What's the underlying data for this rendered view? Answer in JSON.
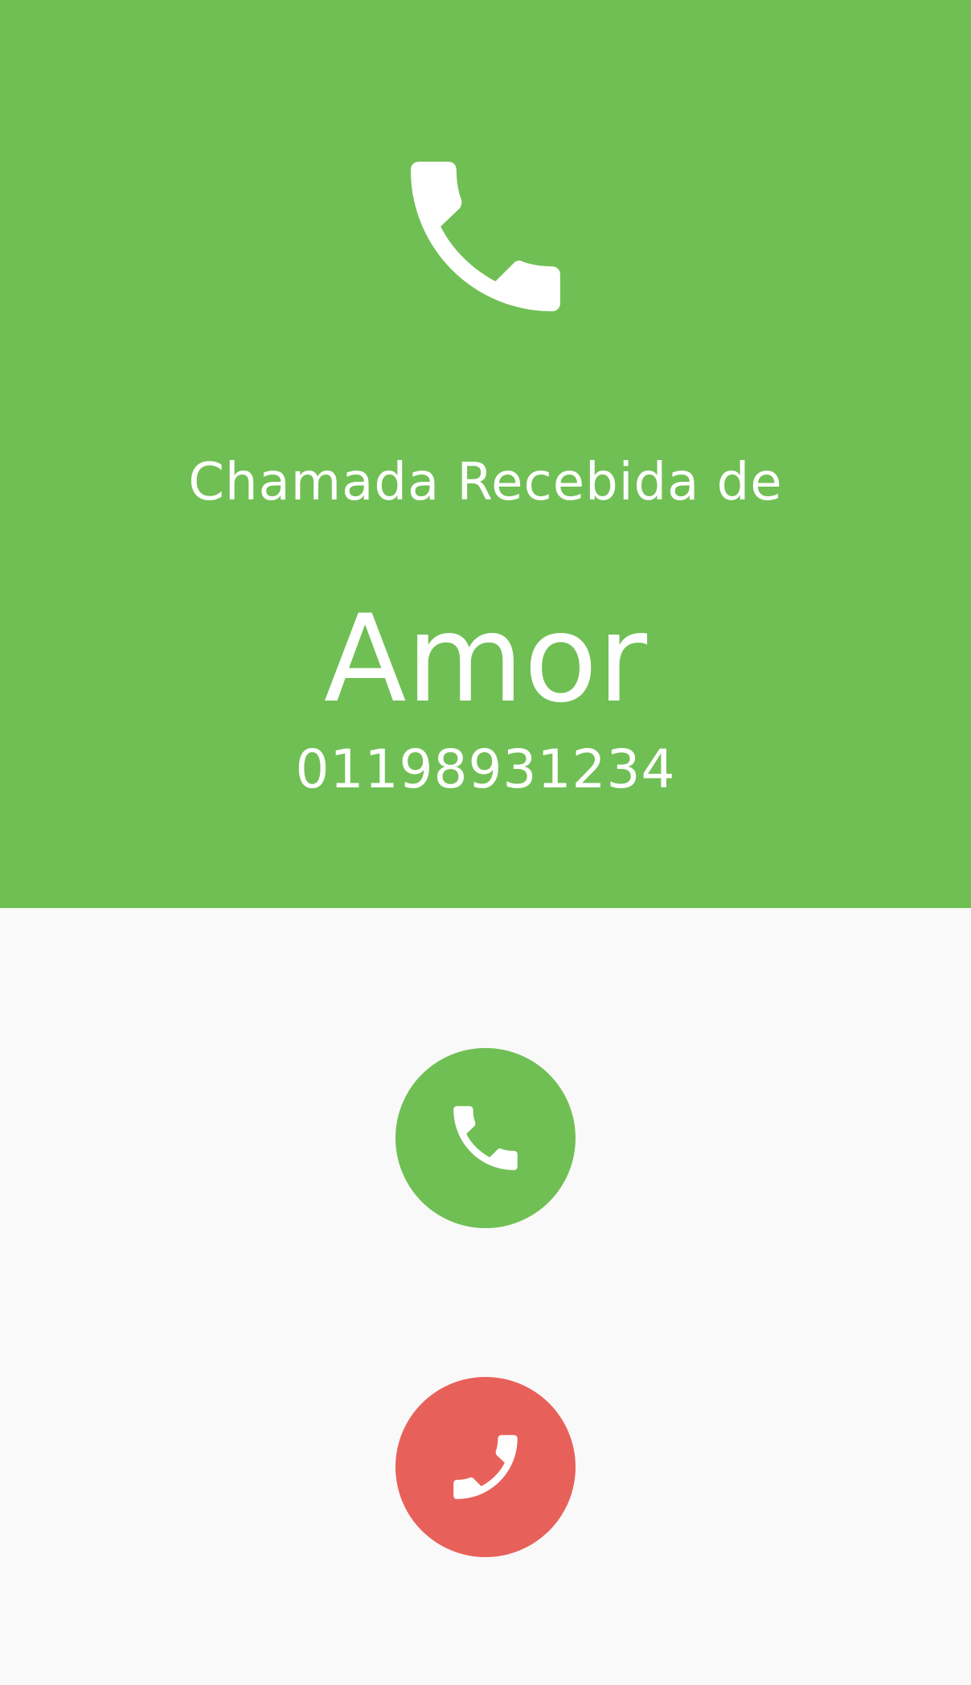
{
  "call": {
    "caption": "Chamada Recebida de",
    "contact_name": "Amor",
    "contact_number": "01198931234"
  },
  "icons": {
    "hero": "phone-icon",
    "accept": "phone-icon",
    "reject": "phone-icon"
  },
  "colors": {
    "header_background": "#70bf54",
    "page_background": "#f9f9f9",
    "accept_button": "#70bf54",
    "reject_button": "#e8605a",
    "text": "#ffffff"
  }
}
